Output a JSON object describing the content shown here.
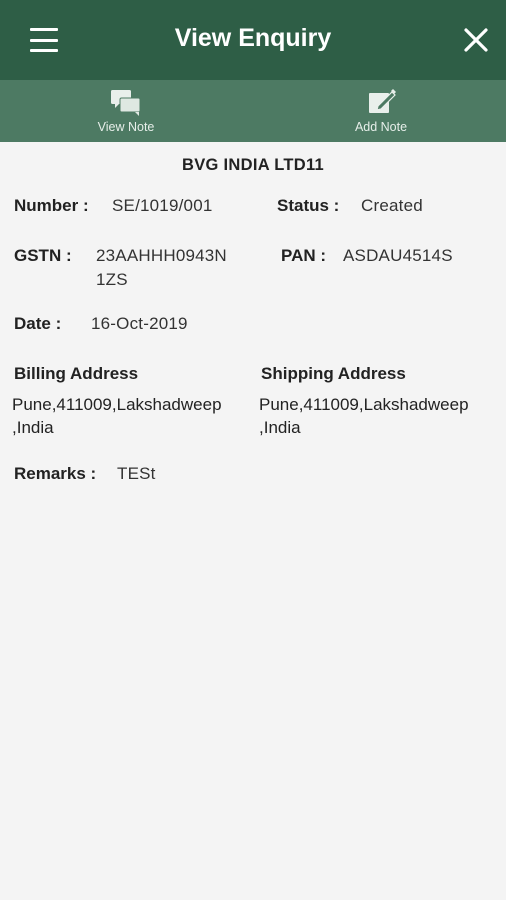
{
  "appbar": {
    "title": "View Enquiry",
    "menu_icon": "hamburger-menu-icon",
    "close_icon": "close-icon",
    "color": "#2e5e46"
  },
  "toolbar": {
    "color": "#4d7a63",
    "view_note_label": "View Note",
    "add_note_label": "Add Note"
  },
  "enquiry": {
    "company": "BVG INDIA LTD11",
    "number_label": "Number :",
    "number": "SE/1019/001",
    "status_label": "Status :",
    "status": "Created",
    "gstn_label": "GSTN :",
    "gstn_line1": "23AAHHH0943N",
    "gstn_line2": "1ZS",
    "pan_label": "PAN :",
    "pan": "ASDAU4514S",
    "date_label": "Date :",
    "date": "16-Oct-2019",
    "billing_title": "Billing Address",
    "billing_line1": "Pune,411009,Lakshadweep",
    "billing_line2": ",India",
    "shipping_title": "Shipping Address",
    "shipping_line1": "Pune,411009,Lakshadweep",
    "shipping_line2": ",India",
    "remarks_label": "Remarks :",
    "remarks": "TESt"
  }
}
